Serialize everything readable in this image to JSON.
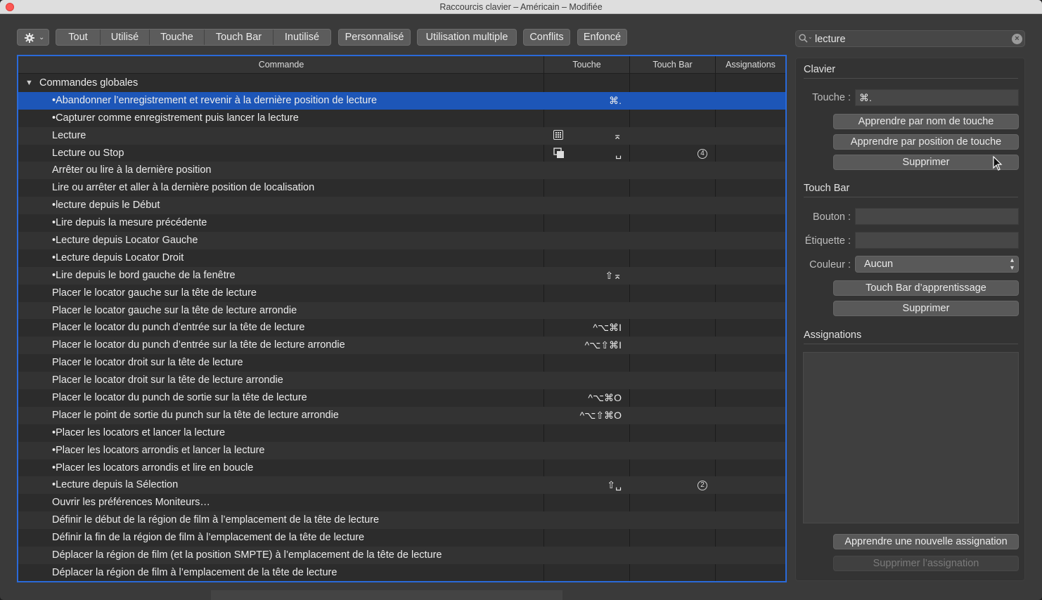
{
  "window": {
    "title": "Raccourcis clavier – Américain – Modifiée"
  },
  "toolbar": {
    "gear_icon": "gear-icon",
    "filters": [
      "Tout",
      "Utilisé",
      "Touche",
      "Touch Bar",
      "Inutilisé"
    ],
    "personnalise": "Personnalisé",
    "utilisation_multiple": "Utilisation multiple",
    "conflits": "Conflits",
    "enfonce": "Enfoncé"
  },
  "search": {
    "value": "lecture"
  },
  "table": {
    "columns": {
      "commande": "Commande",
      "touche": "Touche",
      "touchbar": "Touch Bar",
      "assignations": "Assignations"
    },
    "group": "Commandes globales",
    "rows": [
      {
        "command": "•Abandonner l’enregistrement et revenir à la dernière position de lecture",
        "key": "⌘.",
        "touchbar": "",
        "selected": true
      },
      {
        "command": "•Capturer comme enregistrement puis lancer la lecture",
        "key": "",
        "touchbar": ""
      },
      {
        "command": "Lecture",
        "key": "⌅",
        "key_icon": "keypad-icon",
        "touchbar": ""
      },
      {
        "command": "Lecture ou Stop",
        "key": "␣",
        "key_icon": "multi-window-icon",
        "touchbar": "4"
      },
      {
        "command": "Arrêter ou lire à la dernière position",
        "key": "",
        "touchbar": ""
      },
      {
        "command": "Lire ou arrêter et aller à la dernière position de localisation",
        "key": "",
        "touchbar": ""
      },
      {
        "command": "•lecture depuis le Début",
        "key": "",
        "touchbar": ""
      },
      {
        "command": "•Lire depuis la mesure précédente",
        "key": "",
        "touchbar": ""
      },
      {
        "command": "•Lecture depuis Locator Gauche",
        "key": "",
        "touchbar": ""
      },
      {
        "command": "•Lecture depuis Locator Droit",
        "key": "",
        "touchbar": ""
      },
      {
        "command": "•Lire depuis le bord gauche de la fenêtre",
        "key": "⇧⌅",
        "touchbar": ""
      },
      {
        "command": "Placer le locator gauche sur la tête de lecture",
        "key": "",
        "touchbar": ""
      },
      {
        "command": "Placer le locator gauche sur la tête de lecture arrondie",
        "key": "",
        "touchbar": ""
      },
      {
        "command": "Placer le locator du punch d’entrée sur la tête de lecture",
        "key": "^⌥⌘I",
        "touchbar": ""
      },
      {
        "command": "Placer le locator du punch d’entrée sur la tête de lecture arrondie",
        "key": "^⌥⇧⌘I",
        "touchbar": ""
      },
      {
        "command": "Placer le locator droit sur la tête de lecture",
        "key": "",
        "touchbar": ""
      },
      {
        "command": "Placer le locator droit sur la tête de lecture arrondie",
        "key": "",
        "touchbar": ""
      },
      {
        "command": "Placer le locator du punch de sortie sur la tête de lecture",
        "key": "^⌥⌘O",
        "touchbar": ""
      },
      {
        "command": "Placer le point de sortie du punch sur la tête de lecture arrondie",
        "key": "^⌥⇧⌘O",
        "touchbar": ""
      },
      {
        "command": "•Placer les locators et lancer la lecture",
        "key": "",
        "touchbar": ""
      },
      {
        "command": "•Placer les locators arrondis et lancer la lecture",
        "key": "",
        "touchbar": ""
      },
      {
        "command": "•Placer les locators arrondis et lire en boucle",
        "key": "",
        "touchbar": ""
      },
      {
        "command": "•Lecture depuis la Sélection",
        "key": "⇧␣",
        "touchbar": "2"
      },
      {
        "command": "Ouvrir les préférences Moniteurs…",
        "key": "",
        "touchbar": ""
      },
      {
        "command": "Définir le début de la région de film à l’emplacement de la tête de lecture",
        "key": "",
        "touchbar": ""
      },
      {
        "command": "Définir la fin de la région de film à l’emplacement de la tête de lecture",
        "key": "",
        "touchbar": ""
      },
      {
        "command": "Déplacer la région de film (et la position SMPTE) à l’emplacement de la tête de lecture",
        "key": "",
        "touchbar": ""
      },
      {
        "command": "Déplacer la région de film à l’emplacement de la tête de lecture",
        "key": "",
        "touchbar": ""
      }
    ]
  },
  "panel": {
    "clavier": {
      "title": "Clavier",
      "touche_label": "Touche :",
      "touche_value": "⌘.",
      "learn_by_name": "Apprendre par nom de touche",
      "learn_by_position": "Apprendre par position de touche",
      "delete": "Supprimer"
    },
    "touchbar": {
      "title": "Touch Bar",
      "bouton_label": "Bouton :",
      "etiquette_label": "Étiquette :",
      "couleur_label": "Couleur :",
      "couleur_value": "Aucun",
      "learn": "Touch Bar d’apprentissage",
      "delete": "Supprimer"
    },
    "assignations": {
      "title": "Assignations",
      "learn_new": "Apprendre une nouvelle assignation",
      "delete": "Supprimer l’assignation"
    }
  },
  "colors": {
    "selection": "#1d56b8",
    "focus_ring": "#2a6ad9",
    "close_button": "#fc5753"
  }
}
